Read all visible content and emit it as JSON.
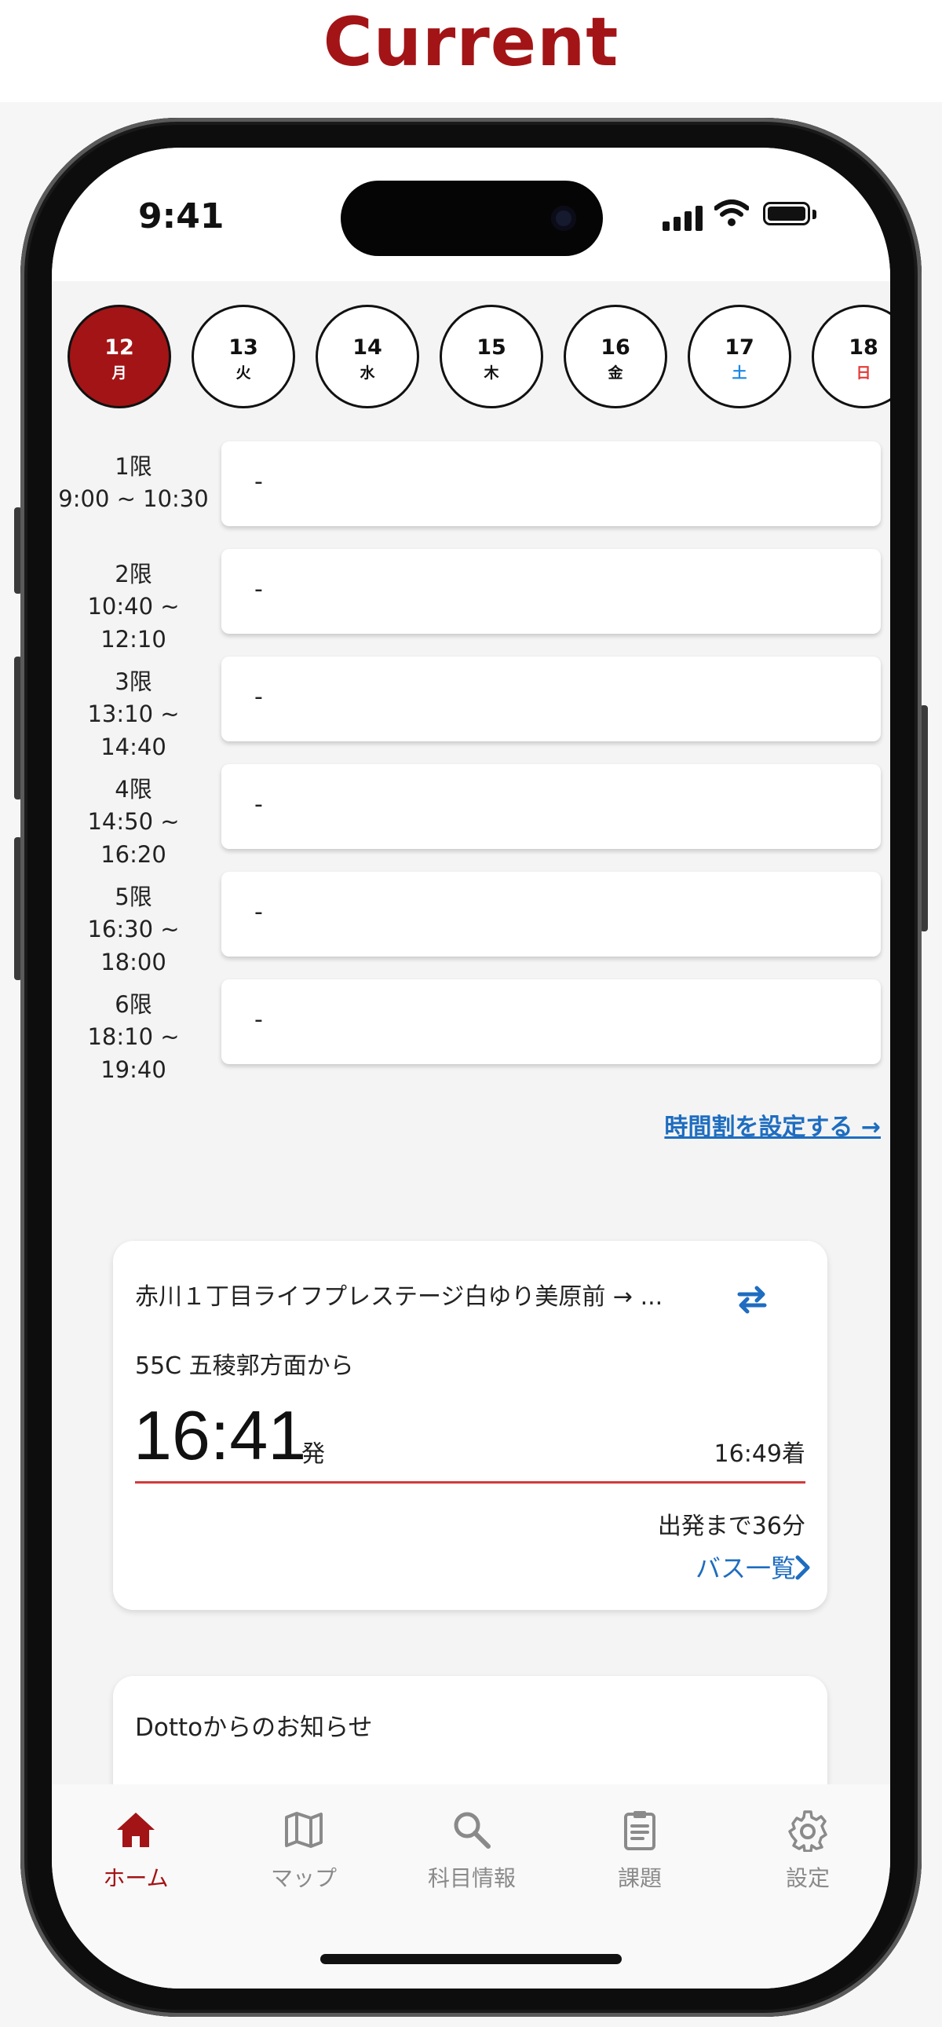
{
  "heading": "Current",
  "status_bar": {
    "time": "9:41"
  },
  "days": [
    {
      "num": "12",
      "weekday": "月",
      "selected": true,
      "weekday_color": "#ffffff"
    },
    {
      "num": "13",
      "weekday": "火",
      "selected": false,
      "weekday_color": "#111111"
    },
    {
      "num": "14",
      "weekday": "水",
      "selected": false,
      "weekday_color": "#111111"
    },
    {
      "num": "15",
      "weekday": "木",
      "selected": false,
      "weekday_color": "#111111"
    },
    {
      "num": "16",
      "weekday": "金",
      "selected": false,
      "weekday_color": "#111111"
    },
    {
      "num": "17",
      "weekday": "土",
      "selected": false,
      "weekday_color": "#1e88e5"
    },
    {
      "num": "18",
      "weekday": "日",
      "selected": false,
      "weekday_color": "#e53935"
    }
  ],
  "periods": [
    {
      "name": "1限",
      "time": "9:00 ~ 10:30",
      "subject": "-"
    },
    {
      "name": "2限",
      "time": "10:40 ~ 12:10",
      "subject": "-"
    },
    {
      "name": "3限",
      "time": "13:10 ~ 14:40",
      "subject": "-"
    },
    {
      "name": "4限",
      "time": "14:50 ~ 16:20",
      "subject": "-"
    },
    {
      "name": "5限",
      "time": "16:30 ~ 18:00",
      "subject": "-"
    },
    {
      "name": "6限",
      "time": "18:10 ~ 19:40",
      "subject": "-"
    }
  ],
  "timetable_link": "時間割を設定する →",
  "bus": {
    "route": "赤川１丁目ライフプレステージ白ゆり美原前 → ...",
    "line": "55C 五稜郭方面から",
    "departure_time": "16:41",
    "departure_suffix": "発",
    "arrival": "16:49着",
    "countdown": "出発まで36分",
    "list_link": "バス一覧",
    "progress": 0,
    "accent_color": "#1e6dc0"
  },
  "notice": {
    "title": "Dottoからのお知らせ"
  },
  "tabs": [
    {
      "label": "ホーム",
      "icon": "home-icon",
      "active": true
    },
    {
      "label": "マップ",
      "icon": "map-icon",
      "active": false
    },
    {
      "label": "科目情報",
      "icon": "search-icon",
      "active": false
    },
    {
      "label": "課題",
      "icon": "clipboard-icon",
      "active": false
    },
    {
      "label": "設定",
      "icon": "gear-icon",
      "active": false
    }
  ],
  "colors": {
    "brand": "#a31416",
    "link": "#1e6dc0",
    "inactive_tab": "#8a8a8a"
  }
}
